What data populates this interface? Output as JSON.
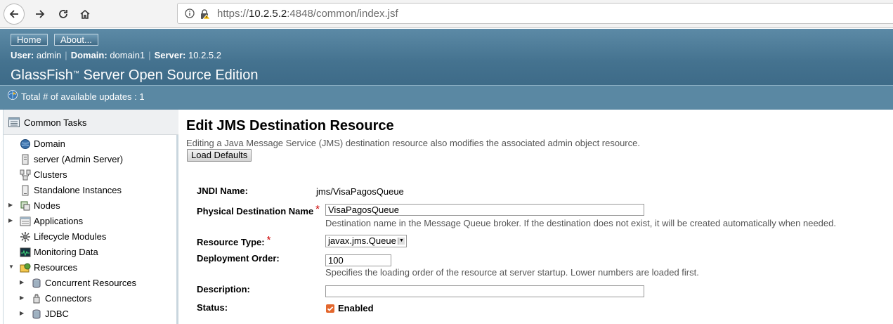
{
  "browser": {
    "url_host": "10.2.5.2",
    "url_rest": ":4848/common/index.jsf",
    "url_scheme": "https://"
  },
  "header": {
    "home_label": "Home",
    "about_label": "About...",
    "user_label": "User:",
    "user_value": "admin",
    "domain_label": "Domain:",
    "domain_value": "domain1",
    "server_label": "Server:",
    "server_value": "10.2.5.2",
    "product_title": "GlassFish",
    "product_tm": "™",
    "product_rest": " Server Open Source Edition",
    "updates_text": "Total # of available updates : 1"
  },
  "sidebar": {
    "title": "Common Tasks",
    "items": [
      {
        "label": "Domain",
        "icon": "globe-icon"
      },
      {
        "label": "server (Admin Server)",
        "icon": "server-icon"
      },
      {
        "label": "Clusters",
        "icon": "clusters-icon"
      },
      {
        "label": "Standalone Instances",
        "icon": "instance-icon"
      },
      {
        "label": "Nodes",
        "icon": "nodes-icon",
        "expand": "collapsed"
      },
      {
        "label": "Applications",
        "icon": "applications-icon",
        "expand": "collapsed"
      },
      {
        "label": "Lifecycle Modules",
        "icon": "lifecycle-icon"
      },
      {
        "label": "Monitoring Data",
        "icon": "monitoring-icon"
      },
      {
        "label": "Resources",
        "icon": "resources-icon",
        "expand": "expanded"
      },
      {
        "label": "Concurrent Resources",
        "icon": "database-icon",
        "expand": "collapsed"
      },
      {
        "label": "Connectors",
        "icon": "connectors-icon",
        "expand": "collapsed"
      },
      {
        "label": "JDBC",
        "icon": "database-icon",
        "expand": "collapsed"
      }
    ],
    "expand_arrow_collapsed": "▶",
    "expand_arrow_expanded": "▼"
  },
  "main": {
    "heading": "Edit JMS Destination Resource",
    "help": "Editing a Java Message Service (JMS) destination resource also modifies the associated admin object resource.",
    "load_defaults_label": "Load Defaults",
    "required_mark": "*",
    "fields": {
      "jndi_label": "JNDI Name:",
      "jndi_value": "jms/VisaPagosQueue",
      "phys_label": "Physical Destination Name",
      "phys_value": "VisaPagosQueue",
      "phys_help": "Destination name in the Message Queue broker. If the destination does not exist, it will be created automatically when needed.",
      "rtype_label": "Resource Type:",
      "rtype_value": "javax.jms.Queue",
      "order_label": "Deployment Order:",
      "order_value": "100",
      "order_help": "Specifies the loading order of the resource at server startup. Lower numbers are loaded first.",
      "desc_label": "Description:",
      "desc_value": "",
      "status_label": "Status:",
      "status_value": "Enabled",
      "status_checked": true
    }
  },
  "colors": {
    "masthead": "#44728f",
    "updates_bar": "#5a88a3",
    "required": "#cc0000",
    "checkbox": "#e3672d"
  }
}
